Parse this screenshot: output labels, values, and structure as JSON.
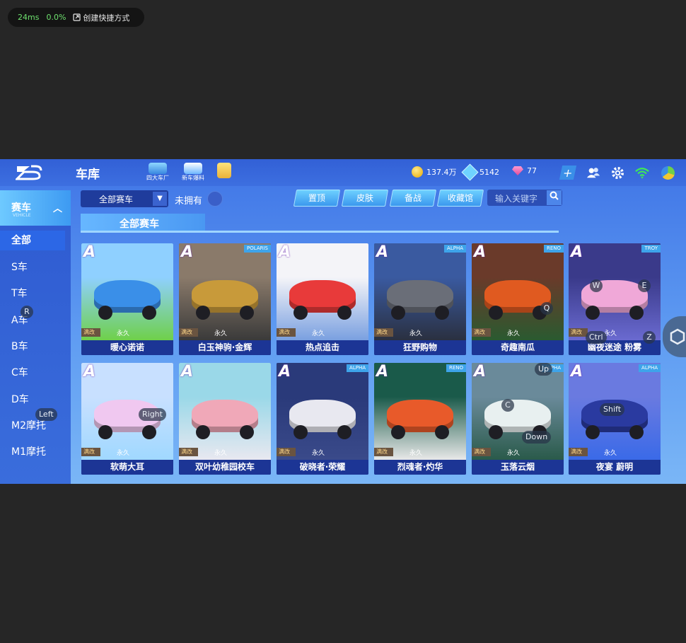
{
  "perf": {
    "latency": "24ms",
    "loss": "0.0%",
    "shortcut": "创建快捷方式"
  },
  "header": {
    "title": "车库",
    "icons": [
      {
        "label": "四大车厂",
        "icon": "car-factory-icon"
      },
      {
        "label": "新车爆料",
        "icon": "new-car-icon"
      },
      {
        "label": "",
        "icon": "gift-box-icon"
      }
    ],
    "coins": "137.4万",
    "tickets": "5142",
    "diamonds": "77"
  },
  "sidebar": {
    "category": "赛车",
    "category_sub": "VEHICLE",
    "items": [
      "全部",
      "S车",
      "T车",
      "A车",
      "B车",
      "C车",
      "D车",
      "M2摩托",
      "M1摩托"
    ]
  },
  "toolbar": {
    "filter": "全部赛车",
    "not_owned": "未拥有",
    "buttons": [
      "置顶",
      "皮肤",
      "备战",
      "收藏馆"
    ],
    "search_placeholder": "输入关键字"
  },
  "section_title": "全部赛车",
  "cars": [
    {
      "name": "暖心诺诺",
      "grade": "A",
      "mod": "满改",
      "duration": "永久",
      "brand": "",
      "colors": [
        "#8fd0ff",
        "#3a8fe8",
        "#6fd04a"
      ]
    },
    {
      "name": "白玉神驹·金辉",
      "grade": "A",
      "mod": "满改",
      "duration": "永久",
      "brand": "POLARIS",
      "colors": [
        "#8a7a6a",
        "#c89a3a",
        "#3a3a3a"
      ]
    },
    {
      "name": "热点追击",
      "grade": "A",
      "mod": "满改",
      "duration": "永久",
      "brand": "",
      "colors": [
        "#f4f4f8",
        "#e83a3a",
        "#7aa0e0"
      ]
    },
    {
      "name": "狂野购物",
      "grade": "A",
      "mod": "满改",
      "duration": "永久",
      "brand": "ALPHA",
      "colors": [
        "#3a5aa0",
        "#6a6e78",
        "#2a3040"
      ]
    },
    {
      "name": "奇趣南瓜",
      "grade": "A",
      "mod": "满改",
      "duration": "永久",
      "brand": "RENO",
      "colors": [
        "#6a3a2a",
        "#e05a20",
        "#2a5a30"
      ]
    },
    {
      "name": "幽夜迷途 粉雾",
      "grade": "A",
      "mod": "满改",
      "duration": "永久",
      "brand": "TROY",
      "colors": [
        "#3a3a8a",
        "#f0a8d8",
        "#6a6ad0"
      ]
    },
    {
      "name": "软萌大耳",
      "grade": "A",
      "mod": "满改",
      "duration": "永久",
      "brand": "",
      "colors": [
        "#c8e0ff",
        "#f0c8f0",
        "#a0d8ff"
      ]
    },
    {
      "name": "双叶幼稚园校车",
      "grade": "A",
      "mod": "满改",
      "duration": "永久",
      "brand": "",
      "colors": [
        "#9ad8e8",
        "#f0a8b8",
        "#e8e8f0"
      ]
    },
    {
      "name": "破晓者·荣耀",
      "grade": "A",
      "mod": "满改",
      "duration": "永久",
      "brand": "ALPHA",
      "colors": [
        "#2a3a7a",
        "#e8e8f0",
        "#3a4a8a"
      ]
    },
    {
      "name": "烈魂者·灼华",
      "grade": "A",
      "mod": "满改",
      "duration": "永久",
      "brand": "RENO",
      "colors": [
        "#1a5a4a",
        "#e85a2a",
        "#e8e8e8"
      ]
    },
    {
      "name": "玉落云烟",
      "grade": "A",
      "mod": "满改",
      "duration": "永久",
      "brand": "ALPHA",
      "colors": [
        "#6a8a9a",
        "#e8f0f0",
        "#2a5a4a"
      ]
    },
    {
      "name": "夜宴 蔚明",
      "grade": "A",
      "mod": "满改",
      "duration": "永久",
      "brand": "ALPHA",
      "colors": [
        "#6a7ae0",
        "#2a3aa0",
        "#3a6ae8"
      ]
    }
  ],
  "key_hints": {
    "r": "R",
    "left": "Left",
    "right": "Right",
    "w": "W",
    "e": "E",
    "q": "Q",
    "ctrl": "Ctrl",
    "z": "Z",
    "up": "Up",
    "c": "C",
    "down": "Down",
    "shift": "Shift"
  }
}
